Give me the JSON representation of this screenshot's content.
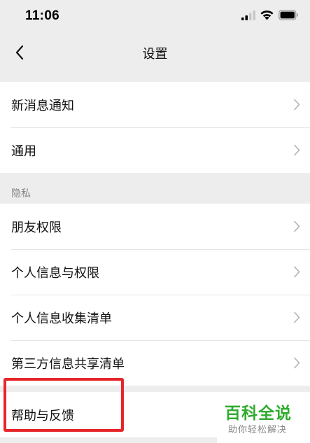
{
  "status_bar": {
    "time": "11:06",
    "icons": [
      "signal-icon",
      "wifi-icon",
      "battery-icon"
    ]
  },
  "nav": {
    "title": "设置",
    "back_icon": "chevron-left-icon"
  },
  "groups": [
    {
      "items": [
        {
          "label": "新消息通知"
        },
        {
          "label": "通用"
        }
      ]
    },
    {
      "header": "隐私",
      "items": [
        {
          "label": "朋友权限"
        },
        {
          "label": "个人信息与权限"
        },
        {
          "label": "个人信息收集清单"
        },
        {
          "label": "第三方信息共享清单"
        }
      ]
    },
    {
      "items": [
        {
          "label": "帮助与反馈"
        }
      ]
    }
  ],
  "watermark": {
    "title": "百科全说",
    "subtitle": "助你轻松解决"
  },
  "colors": {
    "background": "#ededed",
    "highlight": "#e6262a",
    "watermark_green": "#2fab2f"
  }
}
